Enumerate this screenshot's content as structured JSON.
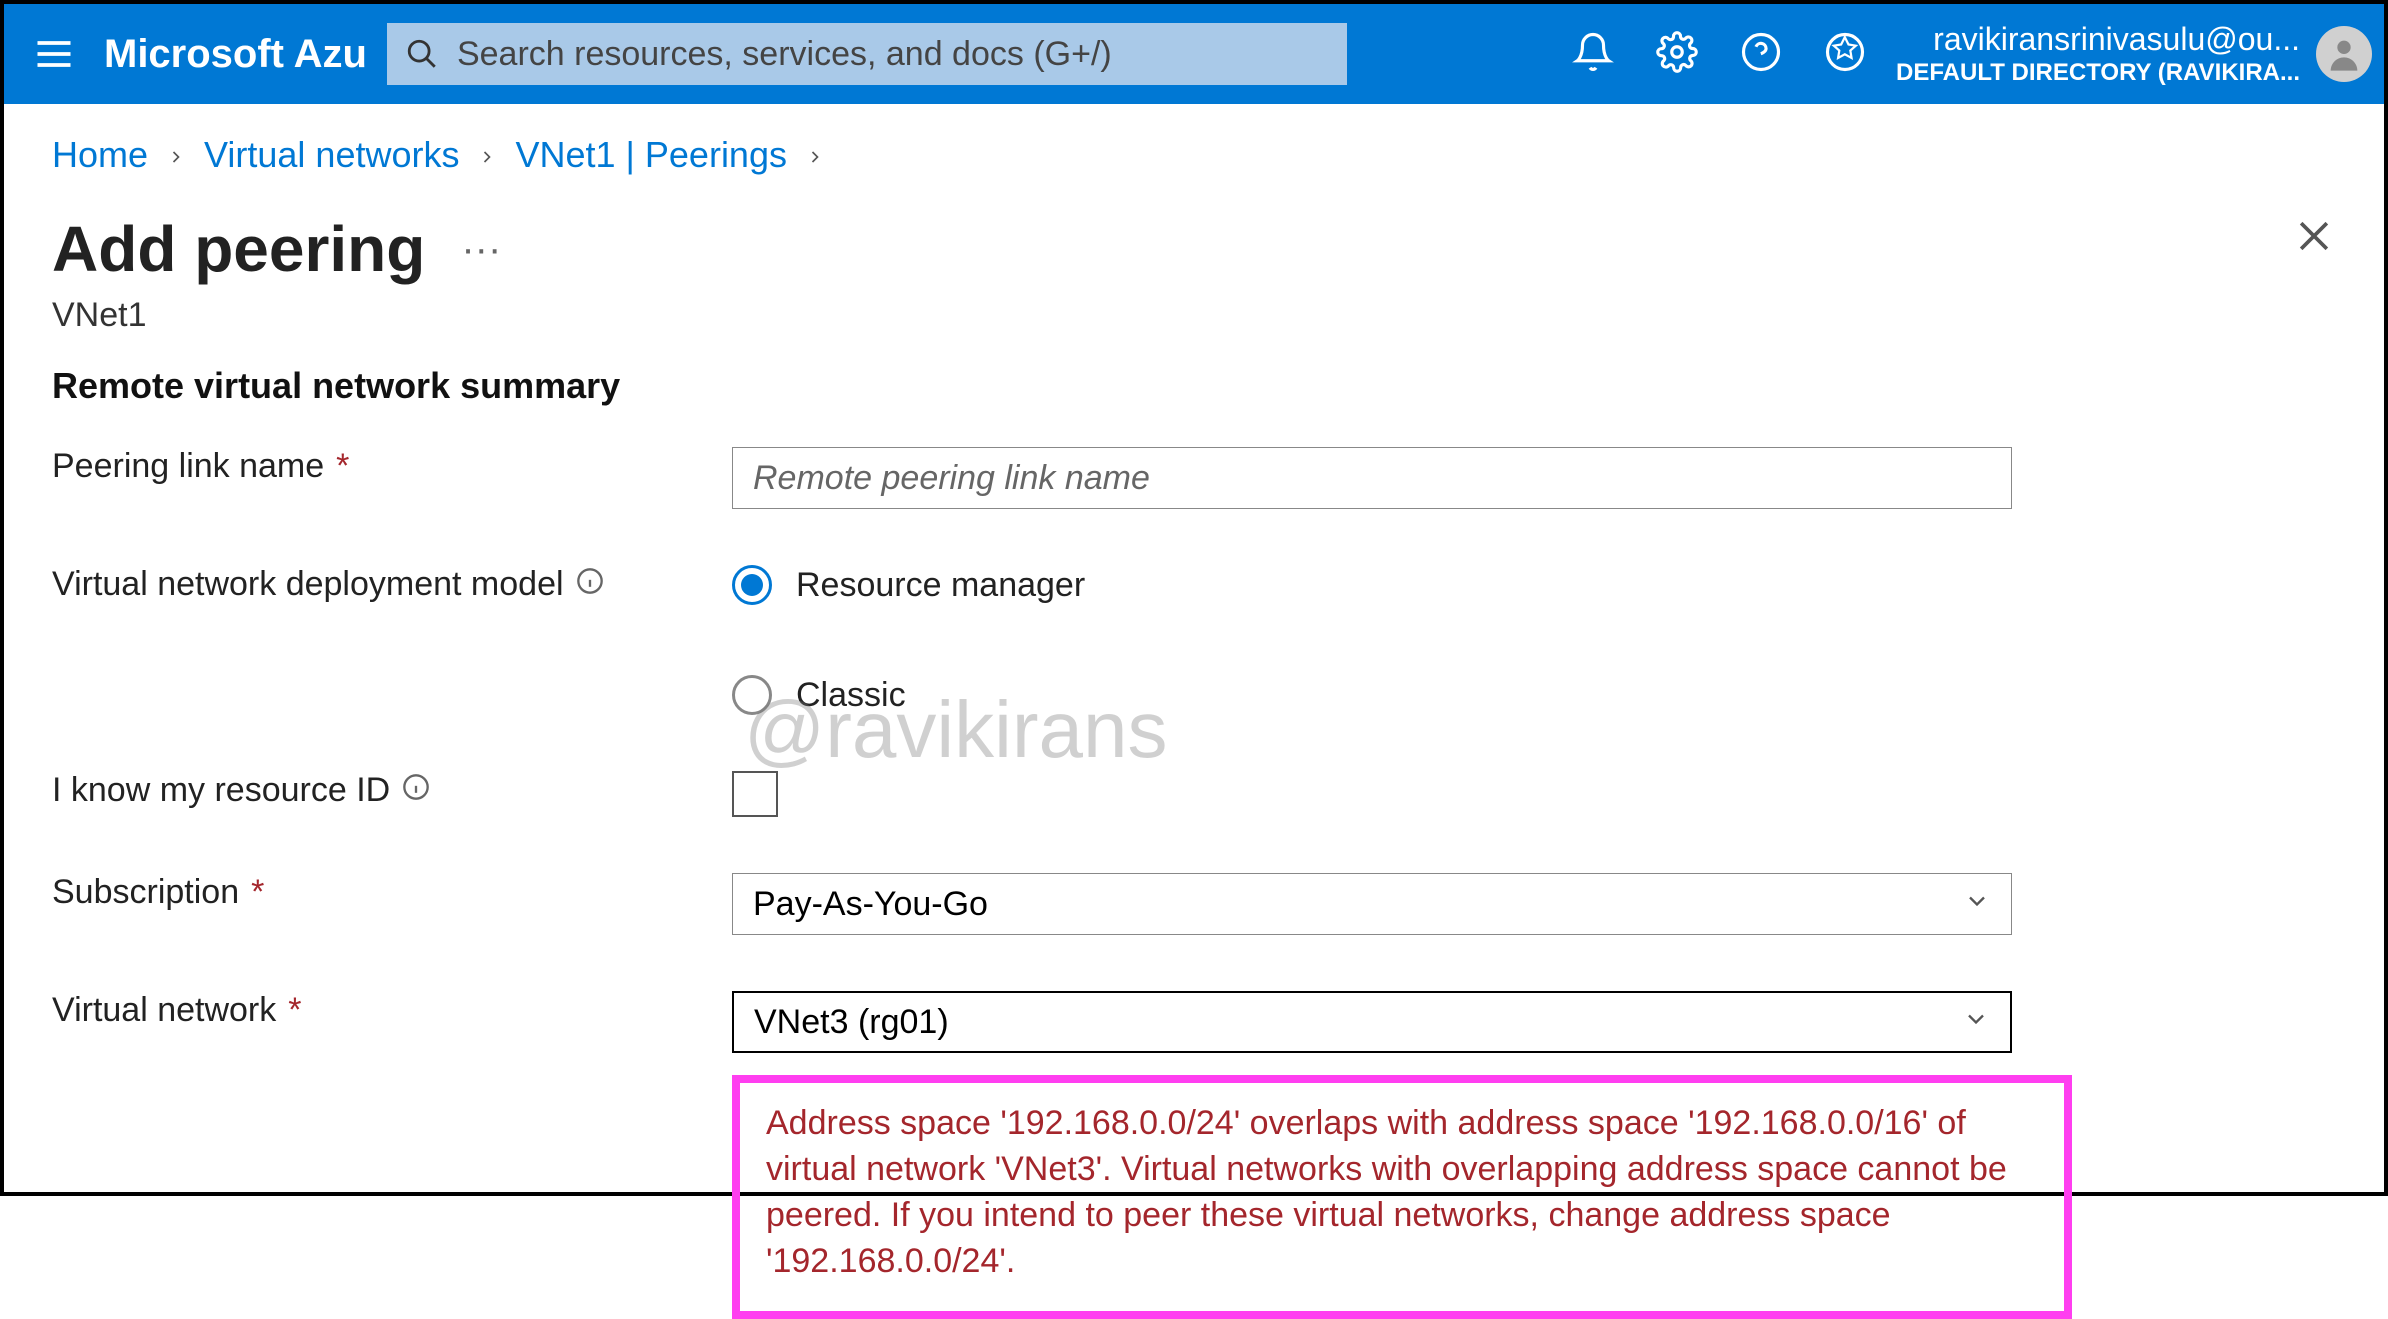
{
  "header": {
    "brand": "Microsoft Azu",
    "search_placeholder": "Search resources, services, and docs (G+/)",
    "account_email": "ravikiransrinivasulu@ou...",
    "account_directory": "DEFAULT DIRECTORY (RAVIKIRA..."
  },
  "breadcrumb": {
    "items": [
      "Home",
      "Virtual networks",
      "VNet1 | Peerings"
    ]
  },
  "page": {
    "title": "Add peering",
    "subtitle": "VNet1",
    "section_header": "Remote virtual network summary"
  },
  "form": {
    "peering_link_label": "Peering link name",
    "peering_link_placeholder": "Remote peering link name",
    "deploy_model_label": "Virtual network deployment model",
    "deploy_model_options": {
      "rm": "Resource manager",
      "classic": "Classic"
    },
    "know_resource_label": "I know my resource ID",
    "subscription_label": "Subscription",
    "subscription_value": "Pay-As-You-Go",
    "vnet_label": "Virtual network",
    "vnet_value": "VNet3 (rg01)",
    "error_message": "Address space '192.168.0.0/24' overlaps with address space '192.168.0.0/16' of virtual network 'VNet3'. Virtual networks with overlapping address space cannot be peered. If you intend to peer these virtual networks, change address space '192.168.0.0/24'."
  },
  "watermark": "@ravikirans"
}
